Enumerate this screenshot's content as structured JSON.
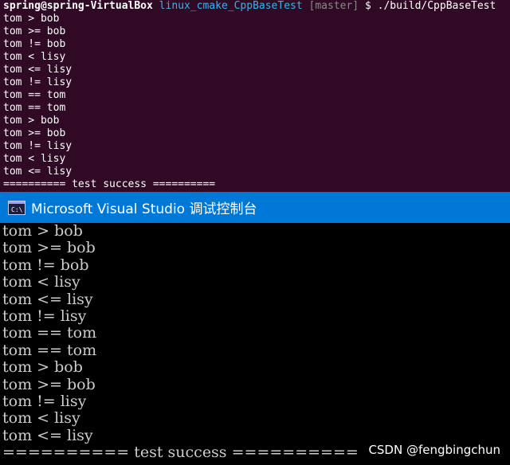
{
  "ubuntu_terminal": {
    "prompt": {
      "user_host": "spring@spring-VirtualBox",
      "path": "linux_cmake_CppBaseTest",
      "branch": "[master]",
      "command": "$ ./build/CppBaseTest"
    },
    "lines": [
      "tom > bob",
      "tom >= bob",
      "tom != bob",
      "tom < lisy",
      "tom <= lisy",
      "tom != lisy",
      "tom == tom",
      "tom == tom",
      "tom > bob",
      "tom >= bob",
      "tom != lisy",
      "tom < lisy",
      "tom <= lisy",
      "========== test success =========="
    ]
  },
  "vs_console": {
    "title": "Microsoft Visual Studio 调试控制台",
    "icon": "console-icon",
    "title_bar_color": "#0078d7",
    "lines": [
      "tom > bob",
      "tom >= bob",
      "tom != bob",
      "tom < lisy",
      "tom <= lisy",
      "tom != lisy",
      "tom == tom",
      "tom == tom",
      "tom > bob",
      "tom >= bob",
      "tom != lisy",
      "tom < lisy",
      "tom <= lisy",
      "========== test success =========="
    ]
  },
  "watermark": "CSDN @fengbingchun"
}
